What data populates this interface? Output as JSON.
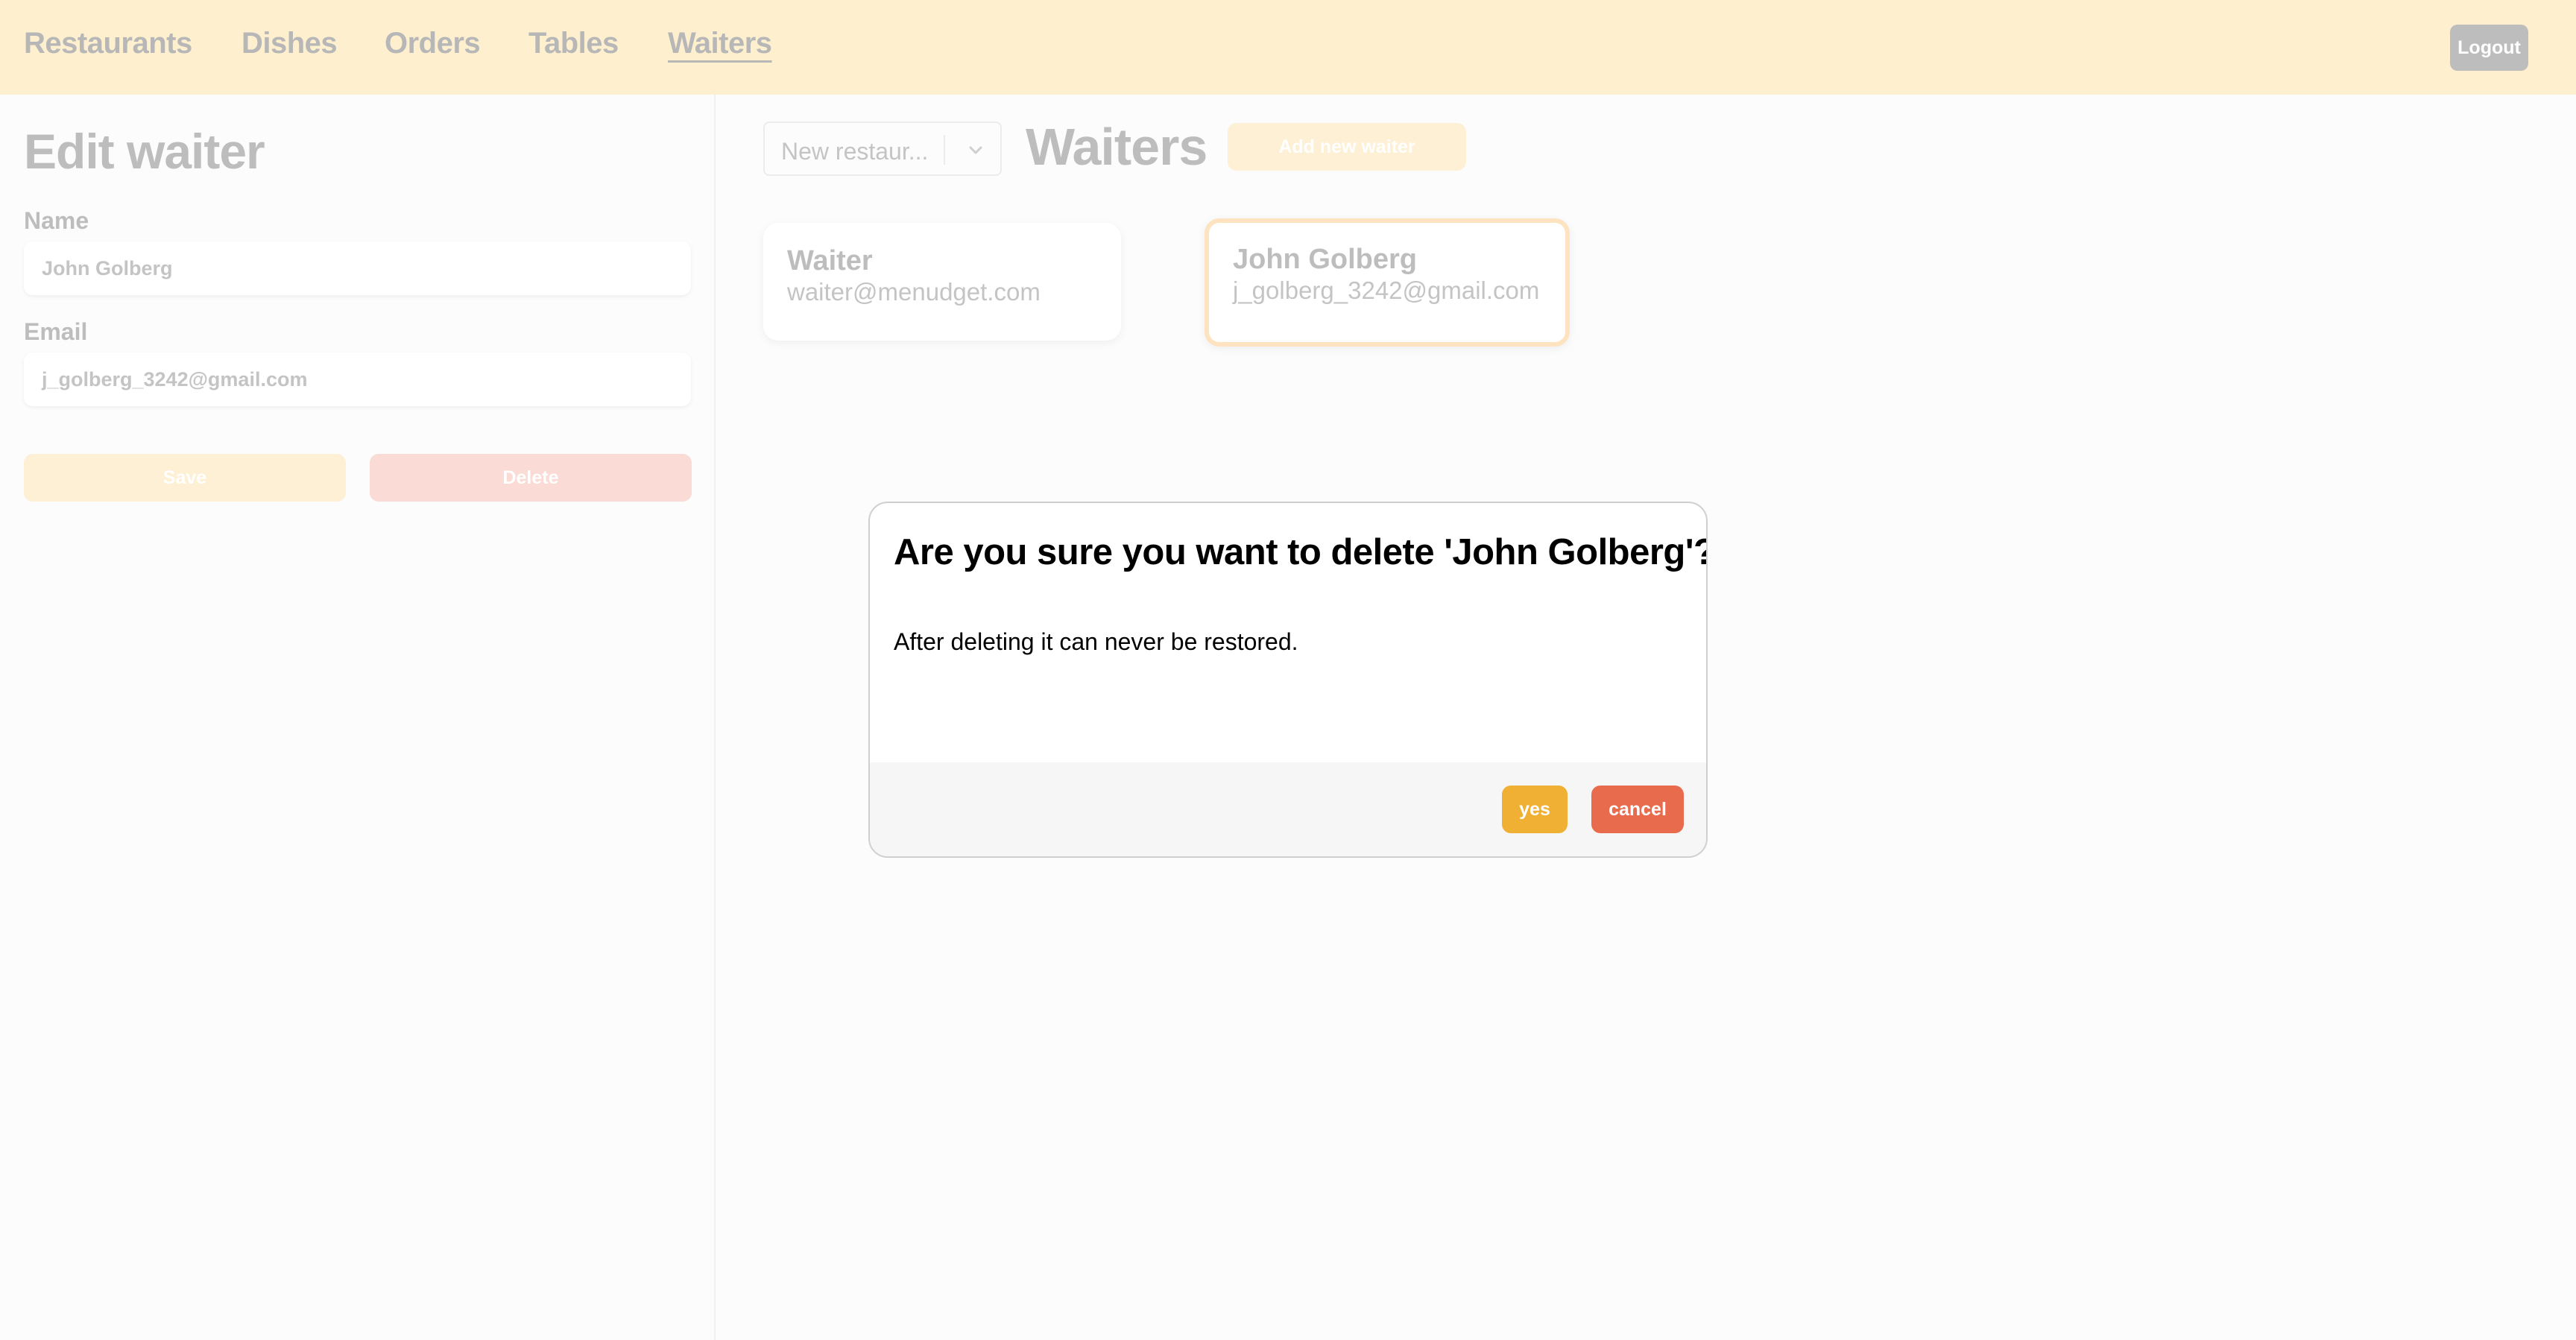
{
  "nav": {
    "items": [
      {
        "label": "Restaurants"
      },
      {
        "label": "Dishes"
      },
      {
        "label": "Orders"
      },
      {
        "label": "Tables"
      },
      {
        "label": "Waiters"
      }
    ],
    "active": "Waiters",
    "logout_label": "Logout"
  },
  "edit_panel": {
    "title": "Edit waiter",
    "name_label": "Name",
    "name_value": "John Golberg",
    "email_label": "Email",
    "email_value": "j_golberg_3242@gmail.com",
    "save_label": "Save",
    "delete_label": "Delete"
  },
  "main": {
    "restaurant_select_value": "New restaur...",
    "heading": "Waiters",
    "add_button_label": "Add new waiter",
    "waiters": [
      {
        "name": "Waiter",
        "email": "waiter@menudget.com"
      },
      {
        "name": "John Golberg",
        "email": "j_golberg_3242@gmail.com"
      }
    ]
  },
  "dialog": {
    "title": "Are you sure you want to delete 'John Golberg'?",
    "message": "After deleting it can never be restored.",
    "yes_label": "yes",
    "cancel_label": "cancel"
  },
  "colors": {
    "topbar_bg": "#fef0cf",
    "yes_button": "#f0b033",
    "cancel_button": "#e96b4d",
    "selected_card_border": "#fde3bf"
  }
}
